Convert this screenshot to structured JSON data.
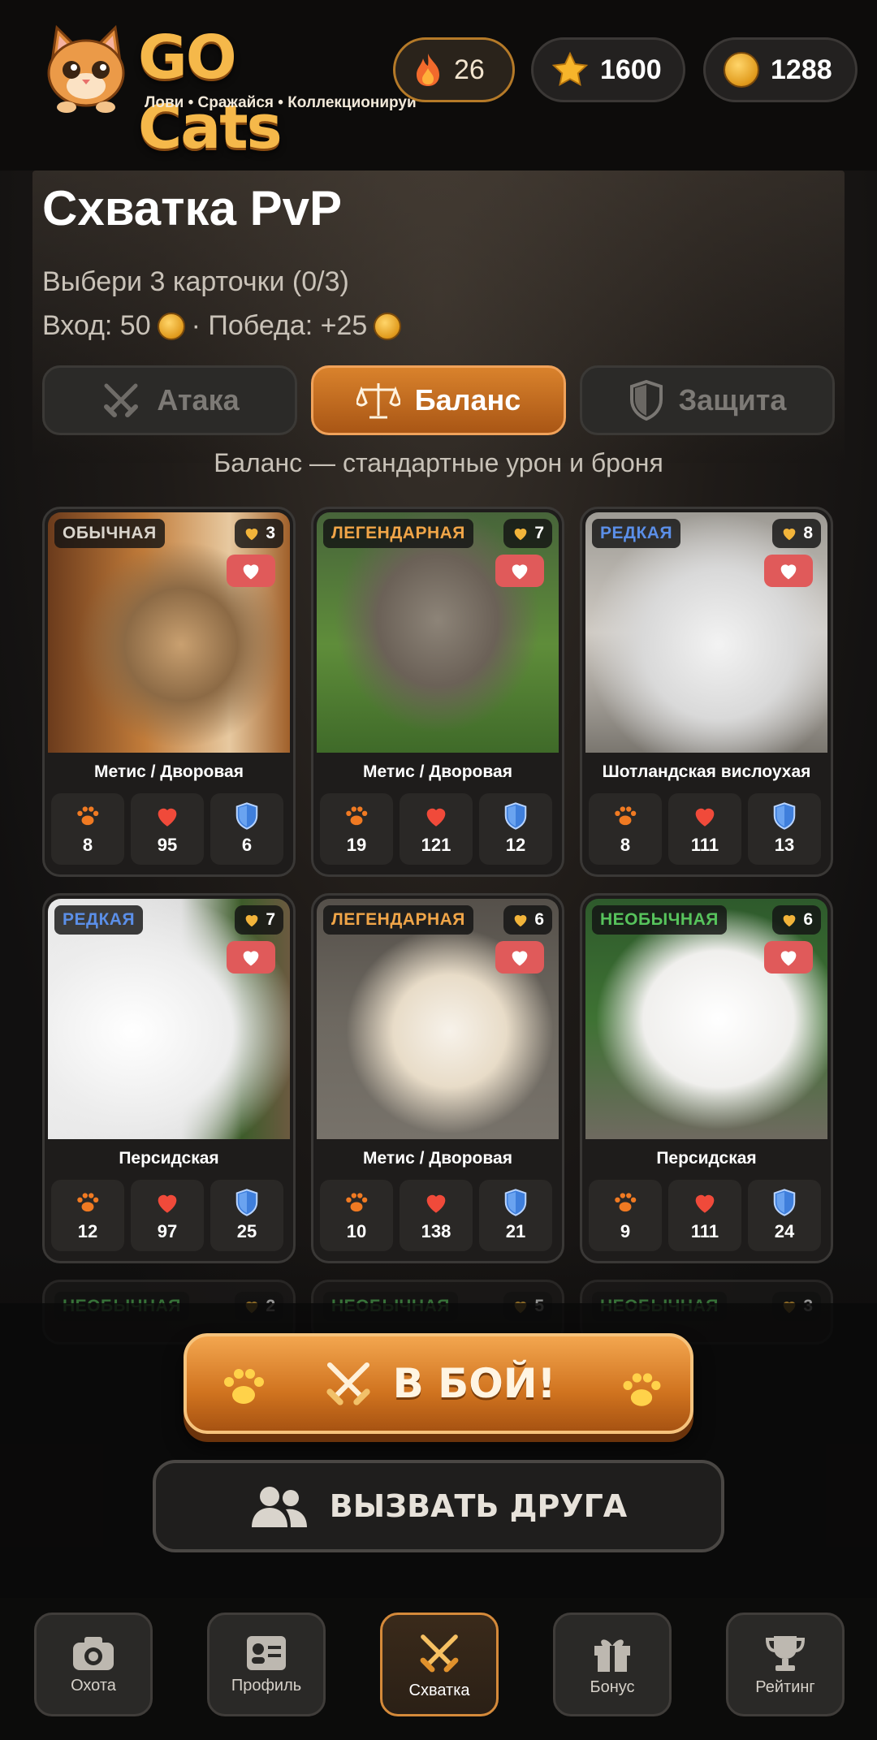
{
  "header": {
    "logo_title": "GO Cats",
    "logo_subtitle": "Лови • Сражайся • Коллекционируй",
    "streak": "26",
    "stars": "1600",
    "coins": "1288"
  },
  "page": {
    "title": "Схватка PvP",
    "select_hint": "Выбери 3 карточки (0/3)",
    "entry_label": "Вход: 50",
    "win_label": "· Победа: +25"
  },
  "modes": {
    "attack": "Атака",
    "balance": "Баланс",
    "defense": "Защита",
    "selected": "balance",
    "description": "Баланс — стандартные урон и броня"
  },
  "cards": [
    {
      "rarity": "ОБЫЧНАЯ",
      "rarity_color": "#d9d4cc",
      "count": "3",
      "breed": "Метис / Дворовая",
      "attack": "8",
      "hp": "95",
      "defense": "6"
    },
    {
      "rarity": "ЛЕГЕНДАРНАЯ",
      "rarity_color": "#f0a548",
      "count": "7",
      "breed": "Метис / Дворовая",
      "attack": "19",
      "hp": "121",
      "defense": "12"
    },
    {
      "rarity": "РЕДКАЯ",
      "rarity_color": "#5b8fe8",
      "count": "8",
      "breed": "Шотландская вислоухая",
      "attack": "8",
      "hp": "111",
      "defense": "13"
    },
    {
      "rarity": "РЕДКАЯ",
      "rarity_color": "#5b8fe8",
      "count": "7",
      "breed": "Персидская",
      "attack": "12",
      "hp": "97",
      "defense": "25"
    },
    {
      "rarity": "ЛЕГЕНДАРНАЯ",
      "rarity_color": "#f0a548",
      "count": "6",
      "breed": "Метис / Дворовая",
      "attack": "10",
      "hp": "138",
      "defense": "21"
    },
    {
      "rarity": "НЕОБЫЧНАЯ",
      "rarity_color": "#57c35c",
      "count": "6",
      "breed": "Персидская",
      "attack": "9",
      "hp": "111",
      "defense": "24"
    }
  ],
  "partial_cards": [
    {
      "rarity": "НЕОБЫЧНАЯ",
      "count": "2"
    },
    {
      "rarity": "НЕОБЫЧНАЯ",
      "count": "5"
    },
    {
      "rarity": "НЕОБЫЧНАЯ",
      "count": "3"
    }
  ],
  "actions": {
    "fight": "В БОЙ!",
    "challenge_friend": "ВЫЗВАТЬ ДРУГА"
  },
  "nav": [
    {
      "label": "Охота",
      "icon": "camera-icon"
    },
    {
      "label": "Профиль",
      "icon": "profile-card-icon"
    },
    {
      "label": "Схватка",
      "icon": "crossed-swords-icon",
      "active": true
    },
    {
      "label": "Бонус",
      "icon": "gift-icon"
    },
    {
      "label": "Рейтинг",
      "icon": "trophy-icon"
    }
  ],
  "colors": {
    "accent": "#d9822c",
    "background": "#0d0c0b",
    "legendary": "#f0a548",
    "rare": "#5b8fe8",
    "uncommon": "#57c35c"
  }
}
